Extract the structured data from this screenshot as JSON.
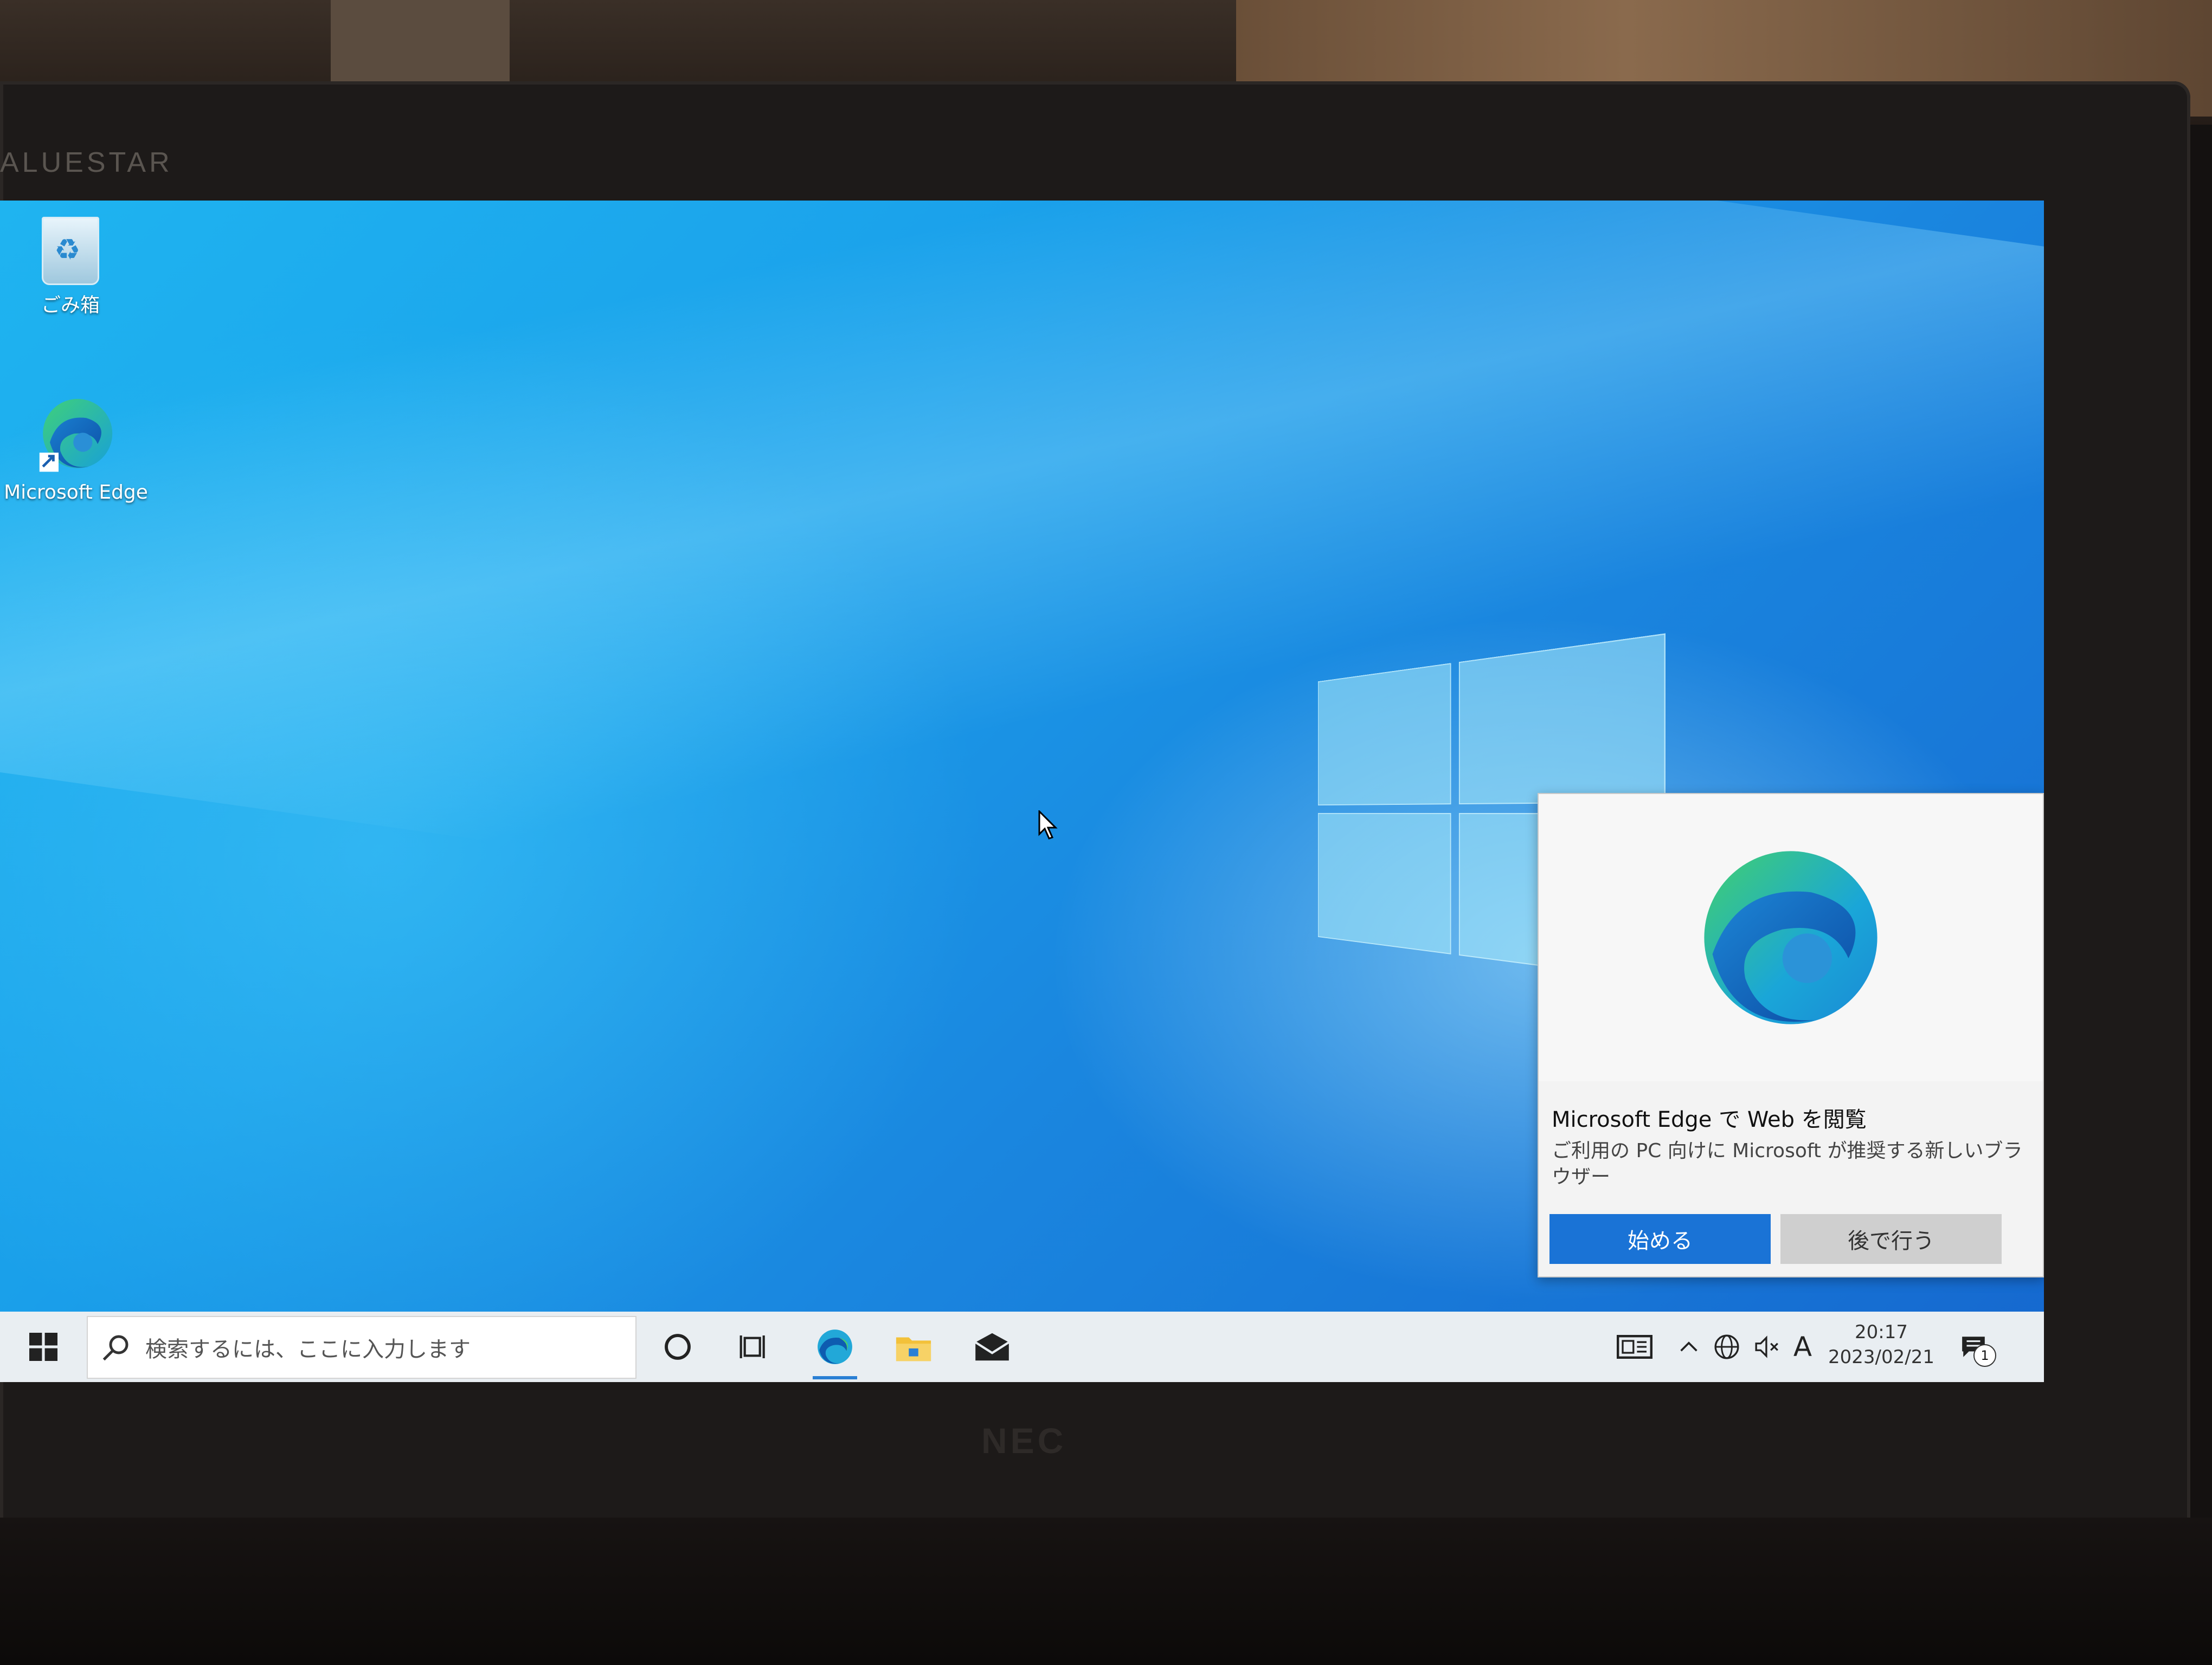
{
  "environment": {
    "monitor_brand": "ALUESTAR",
    "maker": "NEC"
  },
  "desktop": {
    "icons": [
      {
        "label": "ごみ箱",
        "icon": "recycle-bin-icon"
      },
      {
        "label": "Microsoft Edge",
        "icon": "edge-icon"
      }
    ]
  },
  "toast": {
    "title": "Microsoft Edge で Web を閲覧",
    "body": "ご利用の PC 向けに Microsoft が推奨する新しいブラウザー",
    "primary_label": "始める",
    "secondary_label": "後で行う",
    "hero_icon": "edge-icon"
  },
  "taskbar": {
    "search_placeholder": "検索するには、ここに入力します",
    "pinned": [
      "cortana-icon",
      "task-view-icon",
      "edge-icon",
      "file-explorer-icon",
      "mail-icon"
    ],
    "tray": {
      "ime": "A",
      "time": "20:17",
      "date": "2023/02/21",
      "notification_count": "1"
    }
  },
  "colors": {
    "accent": "#1a73d6",
    "taskbar_bg": "#e9eef2",
    "desktop_blue": "#1a9fea"
  }
}
